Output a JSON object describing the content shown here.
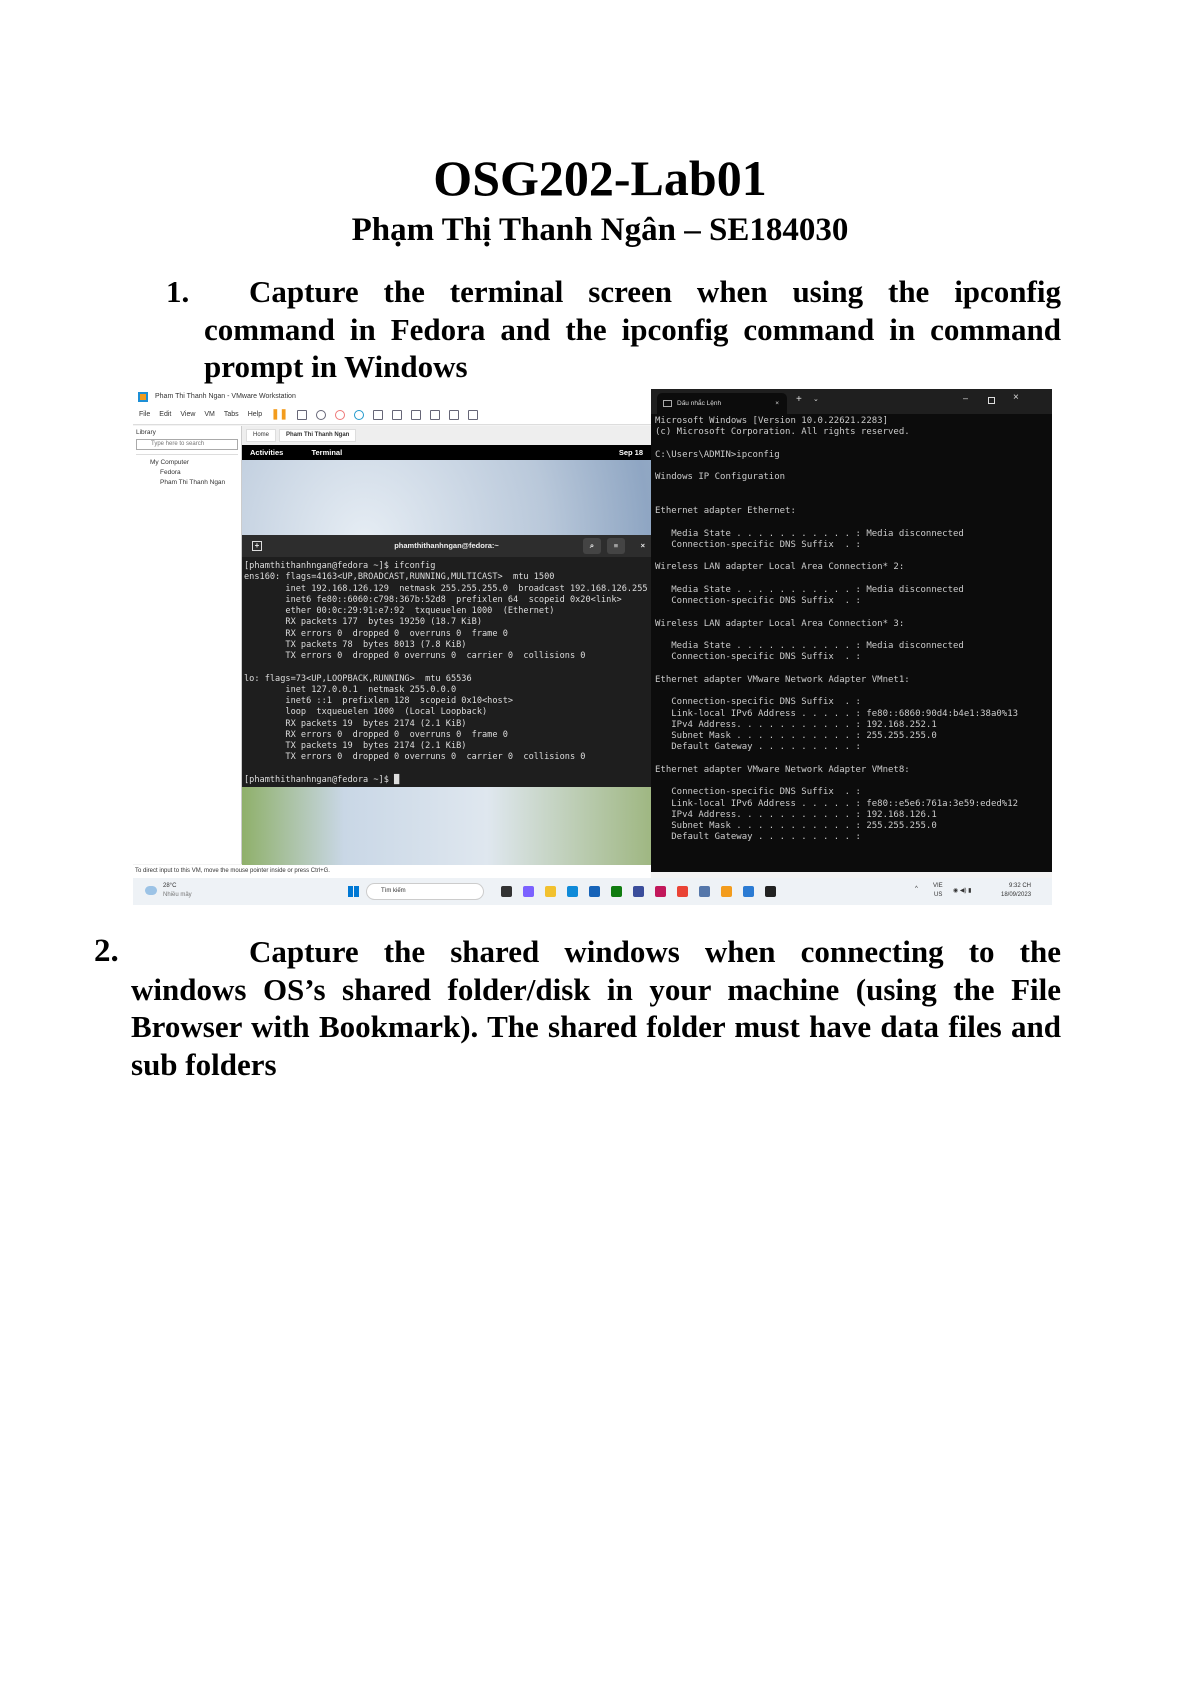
{
  "title": "OSG202-Lab01",
  "subtitle": "Phạm Thị Thanh Ngân – SE184030",
  "questions": [
    {
      "number": "1.",
      "text": "Capture the terminal screen when using the ipconfig command in Fedora and the ipconfig command in command prompt in Windows"
    },
    {
      "number": "2.",
      "text": "Capture the shared windows when connecting to the windows OS’s shared folder/disk in your machine (using the File Browser with Bookmark). The shared folder must have data files and sub folders"
    }
  ],
  "screenshot": {
    "vmware": {
      "window_title": "Pham Thi Thanh Ngan - VMware Workstation",
      "menu": [
        "File",
        "Edit",
        "View",
        "VM",
        "Tabs",
        "Help"
      ],
      "library_label": "Library",
      "search_placeholder": "Type here to search",
      "tree": [
        "My Computer",
        "Fedora",
        "Pham Thi Thanh Ngan"
      ],
      "tabs": [
        "Home",
        "Pham Thi Thanh Ngan"
      ],
      "status": "To direct input to this VM, move the mouse pointer inside or press Ctrl+G."
    },
    "fedora": {
      "activities": "Activities",
      "app": "Terminal",
      "date": "Sep 18",
      "terminal_title": "phamthithanhngan@fedora:~",
      "lines": [
        "[phamthithanhngan@fedora ~]$ ifconfig",
        "ens160: flags=4163<UP,BROADCAST,RUNNING,MULTICAST>  mtu 1500",
        "        inet 192.168.126.129  netmask 255.255.255.0  broadcast 192.168.126.255",
        "        inet6 fe80::6060:c798:367b:52d8  prefixlen 64  scopeid 0x20<link>",
        "        ether 00:0c:29:91:e7:92  txqueuelen 1000  (Ethernet)",
        "        RX packets 177  bytes 19250 (18.7 KiB)",
        "        RX errors 0  dropped 0  overruns 0  frame 0",
        "        TX packets 78  bytes 8013 (7.8 KiB)",
        "        TX errors 0  dropped 0 overruns 0  carrier 0  collisions 0",
        "",
        "lo: flags=73<UP,LOOPBACK,RUNNING>  mtu 65536",
        "        inet 127.0.0.1  netmask 255.0.0.0",
        "        inet6 ::1  prefixlen 128  scopeid 0x10<host>",
        "        loop  txqueuelen 1000  (Local Loopback)",
        "        RX packets 19  bytes 2174 (2.1 KiB)",
        "        RX errors 0  dropped 0  overruns 0  frame 0",
        "        TX packets 19  bytes 2174 (2.1 KiB)",
        "        TX errors 0  dropped 0 overruns 0  carrier 0  collisions 0",
        "",
        "[phamthithanhngan@fedora ~]$ █"
      ]
    },
    "cmd": {
      "tab_title": "Dấu nhắc Lệnh",
      "lines": [
        "Microsoft Windows [Version 10.0.22621.2283]",
        "(c) Microsoft Corporation. All rights reserved.",
        "",
        "C:\\Users\\ADMIN>ipconfig",
        "",
        "Windows IP Configuration",
        "",
        "",
        "Ethernet adapter Ethernet:",
        "",
        "   Media State . . . . . . . . . . . : Media disconnected",
        "   Connection-specific DNS Suffix  . :",
        "",
        "Wireless LAN adapter Local Area Connection* 2:",
        "",
        "   Media State . . . . . . . . . . . : Media disconnected",
        "   Connection-specific DNS Suffix  . :",
        "",
        "Wireless LAN adapter Local Area Connection* 3:",
        "",
        "   Media State . . . . . . . . . . . : Media disconnected",
        "   Connection-specific DNS Suffix  . :",
        "",
        "Ethernet adapter VMware Network Adapter VMnet1:",
        "",
        "   Connection-specific DNS Suffix  . :",
        "   Link-local IPv6 Address . . . . . : fe80::6860:90d4:b4e1:38a0%13",
        "   IPv4 Address. . . . . . . . . . . : 192.168.252.1",
        "   Subnet Mask . . . . . . . . . . . : 255.255.255.0",
        "   Default Gateway . . . . . . . . . :",
        "",
        "Ethernet adapter VMware Network Adapter VMnet8:",
        "",
        "   Connection-specific DNS Suffix  . :",
        "   Link-local IPv6 Address . . . . . : fe80::e5e6:761a:3e59:eded%12",
        "   IPv4 Address. . . . . . . . . . . : 192.168.126.1",
        "   Subnet Mask . . . . . . . . . . . : 255.255.255.0",
        "   Default Gateway . . . . . . . . . :"
      ]
    },
    "taskbar": {
      "temperature": "28°C",
      "weather": "Nhiều mây",
      "search_placeholder": "Tìm kiếm",
      "lang": "VIE",
      "region": "US",
      "time": "9:32 CH",
      "date": "18/09/2023",
      "icon_colors": [
        "#333333",
        "#7b61ff",
        "#f2c12e",
        "#0f8ad8",
        "#1663b8",
        "#107c10",
        "#3a4d9b",
        "#c2185b",
        "#ea4335",
        "#5577aa",
        "#f39c1d",
        "#2b7bd3",
        "#222222"
      ]
    }
  }
}
